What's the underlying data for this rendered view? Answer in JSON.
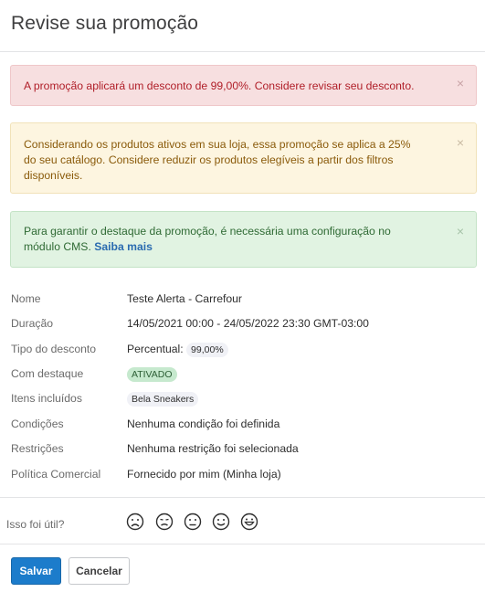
{
  "header": {
    "title": "Revise sua promoção"
  },
  "alerts": {
    "danger": {
      "text": "A promoção aplicará um desconto de 99,00%. Considere revisar seu desconto.",
      "close": "×"
    },
    "warning": {
      "line1": "Considerando os produtos ativos em sua loja, essa promoção se aplica a 25%",
      "line2": "do seu catálogo. Considere reduzir os produtos elegíveis a partir dos filtros",
      "line3": "disponíveis.",
      "close": "×"
    },
    "success": {
      "line1": "Para garantir o destaque da promoção, é necessária uma configuração no",
      "line2": "módulo CMS.",
      "link": "Saiba mais",
      "close": "×"
    }
  },
  "details": {
    "name": {
      "label": "Nome",
      "value": "Teste Alerta - Carrefour"
    },
    "duration": {
      "label": "Duração",
      "value": "14/05/2021 00:00 - 24/05/2022 23:30 GMT-03:00"
    },
    "discount_type": {
      "label": "Tipo do desconto",
      "value": "Percentual:",
      "badge": "99,00%"
    },
    "highlight": {
      "label": "Com destaque",
      "badge": "ATIVADO"
    },
    "included_items": {
      "label": "Itens incluídos",
      "badge": "Bela Sneakers"
    },
    "conditions": {
      "label": "Condições",
      "value": "Nenhuma condição foi definida"
    },
    "restrictions": {
      "label": "Restrições",
      "value": "Nenhuma restrição foi selecionada"
    },
    "commercial_policy": {
      "label": "Política Comercial",
      "value": "Fornecido por mim (Minha loja)"
    }
  },
  "feedback": {
    "question": "Isso foi útil?",
    "faces": [
      "very-sad-face-icon",
      "sad-face-icon",
      "neutral-face-icon",
      "happy-face-icon",
      "very-happy-face-icon"
    ]
  },
  "footer": {
    "save_label": "Salvar",
    "cancel_label": "Cancelar"
  },
  "colors": {
    "primary": "#1c7ccb",
    "danger": "#b01e28",
    "warning": "#8a5a0a",
    "success": "#2f6a34",
    "active_badge": "#c6e9ce"
  }
}
